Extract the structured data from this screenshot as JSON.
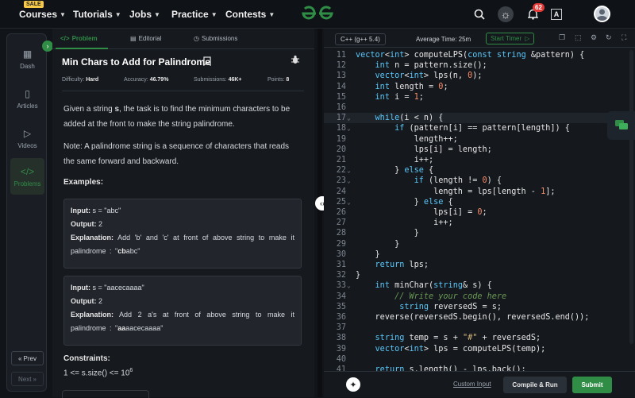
{
  "nav": {
    "sale_badge": "SALE",
    "items": [
      {
        "label": "Courses"
      },
      {
        "label": "Tutorials"
      },
      {
        "label": "Jobs"
      },
      {
        "label": "Practice"
      },
      {
        "label": "Contests"
      }
    ],
    "notification_count": "62",
    "translate_label": "A"
  },
  "sidebar": {
    "items": [
      {
        "label": "Dash",
        "icon": "grid-icon"
      },
      {
        "label": "Articles",
        "icon": "book-icon"
      },
      {
        "label": "Videos",
        "icon": "play-icon"
      },
      {
        "label": "Problems",
        "icon": "code-icon"
      }
    ],
    "prev": "Prev",
    "next": "Next"
  },
  "problem": {
    "tabs": [
      "Problem",
      "Editorial",
      "Submissions"
    ],
    "title": "Min Chars to Add for Palindrome",
    "difficulty_label": "Difficulty:",
    "difficulty": "Hard",
    "accuracy_label": "Accuracy:",
    "accuracy": "46.79%",
    "submissions_label": "Submissions:",
    "submissions": "46K+",
    "points_label": "Points:",
    "points": "8",
    "statement_pre": "Given a string ",
    "statement_var": "s",
    "statement_post": ", the task is to find the minimum characters to be added at the front to make the string palindrome.",
    "note": "Note: A palindrome string is a sequence of characters that reads the same forward and backward.",
    "examples_heading": "Examples:",
    "examples": [
      {
        "input_label": "Input:",
        "input": "s = \"abc\"",
        "output_label": "Output:",
        "output": "2",
        "explanation_label": "Explanation:",
        "explanation_pre": "Add 'b' and 'c' at front of above string to make it palindrome : \"",
        "explanation_bold": "cb",
        "explanation_post": "abc\""
      },
      {
        "input_label": "Input:",
        "input": "s = \"aacecaaaa\"",
        "output_label": "Output:",
        "output": "2",
        "explanation_label": "Explanation:",
        "explanation_pre": "Add 2 a's at front of above string to make it palindrome : \"",
        "explanation_bold": "aa",
        "explanation_post": "aacecaaaa\""
      }
    ],
    "constraints_heading": "Constraints:",
    "constraint_text": "1 <= s.size() <= 10",
    "constraint_exp": "6"
  },
  "editor": {
    "language": "C++ (g++ 5.4)",
    "avg_time": "Average Time: 25m",
    "start_timer": "Start Timer",
    "custom_input": "Custom Input",
    "compile_run": "Compile & Run",
    "submit": "Submit",
    "lines": [
      {
        "n": "11",
        "fold": "",
        "code": "vector<int> computeLPS(const string &pattern) {"
      },
      {
        "n": "12",
        "fold": "",
        "code": "    int n = pattern.size();"
      },
      {
        "n": "13",
        "fold": "",
        "code": "    vector<int> lps(n, 0);"
      },
      {
        "n": "14",
        "fold": "",
        "code": "    int length = 0;"
      },
      {
        "n": "15",
        "fold": "",
        "code": "    int i = 1;"
      },
      {
        "n": "16",
        "fold": "",
        "code": ""
      },
      {
        "n": "17",
        "fold": "⌄",
        "code": "    while(i < n) {"
      },
      {
        "n": "18",
        "fold": "⌄",
        "code": "        if (pattern[i] == pattern[length]) {"
      },
      {
        "n": "19",
        "fold": "",
        "code": "            length++;"
      },
      {
        "n": "20",
        "fold": "",
        "code": "            lps[i] = length;"
      },
      {
        "n": "21",
        "fold": "",
        "code": "            i++;"
      },
      {
        "n": "22",
        "fold": "⌄",
        "code": "        } else {"
      },
      {
        "n": "23",
        "fold": "⌄",
        "code": "            if (length != 0) {"
      },
      {
        "n": "24",
        "fold": "",
        "code": "                length = lps[length - 1];"
      },
      {
        "n": "25",
        "fold": "⌄",
        "code": "            } else {"
      },
      {
        "n": "26",
        "fold": "",
        "code": "                lps[i] = 0;"
      },
      {
        "n": "27",
        "fold": "",
        "code": "                i++;"
      },
      {
        "n": "28",
        "fold": "",
        "code": "            }"
      },
      {
        "n": "29",
        "fold": "",
        "code": "        }"
      },
      {
        "n": "30",
        "fold": "",
        "code": "    }"
      },
      {
        "n": "31",
        "fold": "",
        "code": "    return lps;"
      },
      {
        "n": "32",
        "fold": "",
        "code": "}"
      },
      {
        "n": "33",
        "fold": "⌄",
        "code": "    int minChar(string& s) {"
      },
      {
        "n": "34",
        "fold": "",
        "code": "        // Write your code here"
      },
      {
        "n": "35",
        "fold": "",
        "code": "         string reversedS = s;"
      },
      {
        "n": "36",
        "fold": "",
        "code": "    reverse(reversedS.begin(), reversedS.end());"
      },
      {
        "n": "37",
        "fold": "",
        "code": ""
      },
      {
        "n": "38",
        "fold": "",
        "code": "    string temp = s + \"#\" + reversedS;"
      },
      {
        "n": "39",
        "fold": "",
        "code": "    vector<int> lps = computeLPS(temp);"
      },
      {
        "n": "40",
        "fold": "",
        "code": ""
      },
      {
        "n": "41",
        "fold": "",
        "code": "    return s.length() - lps.back();"
      }
    ]
  }
}
